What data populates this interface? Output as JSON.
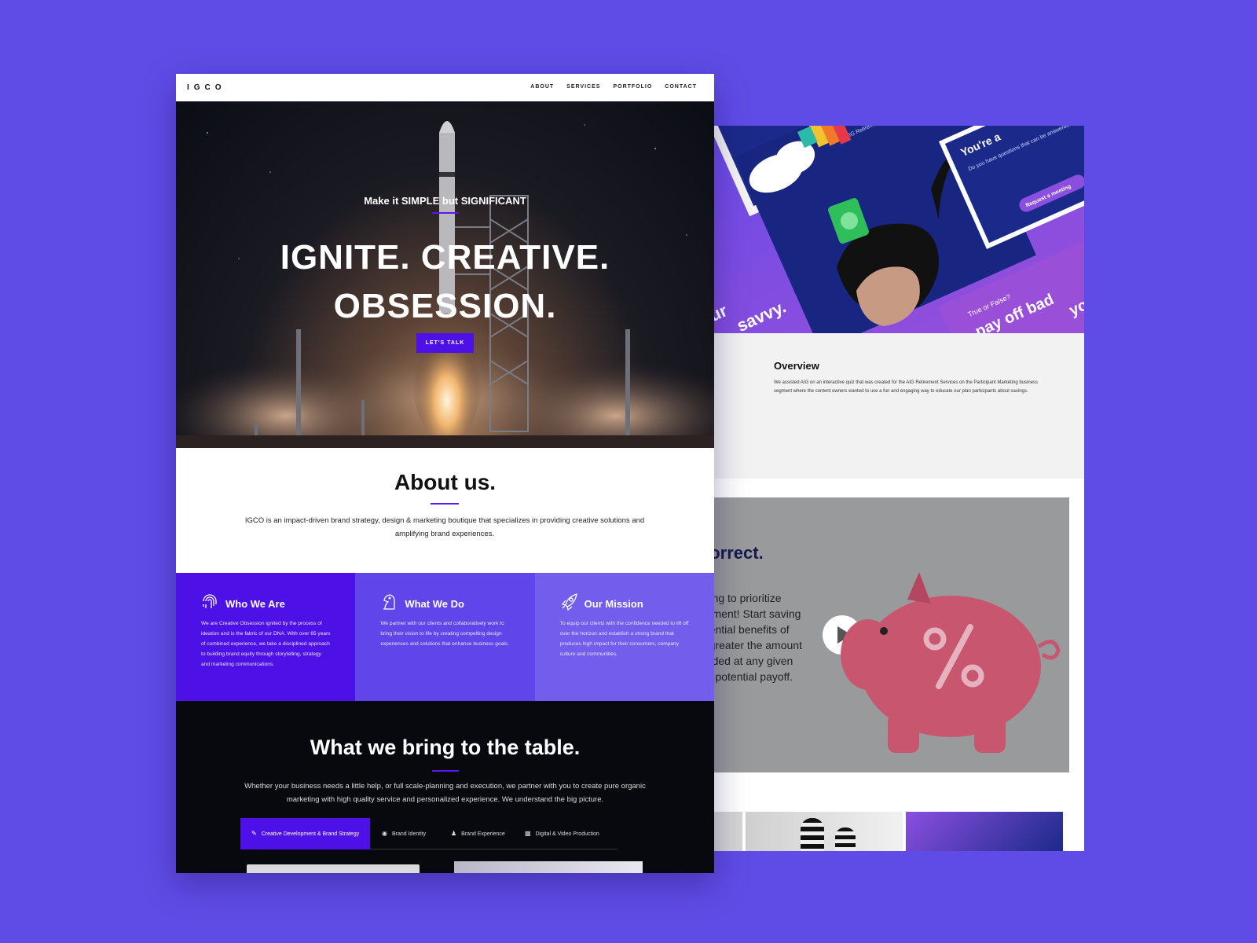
{
  "front": {
    "nav": {
      "logo": "IGCO",
      "items": [
        "ABOUT",
        "SERVICES",
        "PORTFOLIO",
        "CONTACT"
      ]
    },
    "hero": {
      "tagline": "Make it SIMPLE but SIGNIFICANT",
      "title_line1": "IGNITE. CREATIVE.",
      "title_line2": "OBSESSION.",
      "cta": "LET'S TALK"
    },
    "about": {
      "title": "About us.",
      "text": "IGCO is an impact-driven brand strategy, design & marketing boutique that specializes in providing creative solutions and amplifying brand experiences."
    },
    "pillars": [
      {
        "title": "Who We Are",
        "icon": "fingerprint-icon",
        "color": "#4d10e6",
        "text": "We are Creative Obsession ignited by the process of ideation and is the fabric of our DNA. With over 65 years of combined experience, we take a disciplined approach to building brand equity through storytelling, strategy and marketing communications."
      },
      {
        "title": "What We Do",
        "icon": "chess-knight-icon",
        "color": "#6046ea",
        "text": "We partner with our clients and collaboratively work to bring their vision to life by creating compelling design experiences and solutions that enhance business goals."
      },
      {
        "title": "Our Mission",
        "icon": "rocket-icon",
        "color": "#735ded",
        "text": "To equip our clients with the confidence needed to lift off over the horizon and establish a strong brand that produces high impact for their consumers, company culture and communities."
      }
    ],
    "bring": {
      "title": "What we bring to the table.",
      "text": "Whether your business needs a little help, or full scale-planning and execution, we partner with you to create pure organic marketing with high quality service and personalized experience. We understand the big picture.",
      "tabs": [
        "Creative Development & Brand Strategy",
        "Brand Identity",
        "Brand Experience",
        "Digital & Video Production"
      ]
    }
  },
  "back": {
    "hero": {
      "card_brand": "AIG Retirement Services",
      "card_heading": "You're a",
      "card_text": "Do you have questions that can be answered by one of our experts? AIG Retirement Services financial pros can offer guidance to address a spectrum of financial needs.",
      "card_button": "Request a meeting",
      "quiz_text": "True or False?",
      "quiz_line": "pay off bad",
      "quiz_line2": "your",
      "savvy_text": "savvy.",
      "your_text": "our"
    },
    "overview": {
      "title": "Overview",
      "text": "We assisted AIG on an interactive quiz that was created for the AIG Retirement Services on the Participant Marketing business segment where the content owners wanted to use a fun and engaging way to educate our plan participants about savings."
    },
    "video": {
      "heading": "correct.",
      "text": "oung to prioritize\nirement! Start saving\notential benefits of\ne greater the amount\nunded at any given\nhe potential payoff."
    }
  }
}
